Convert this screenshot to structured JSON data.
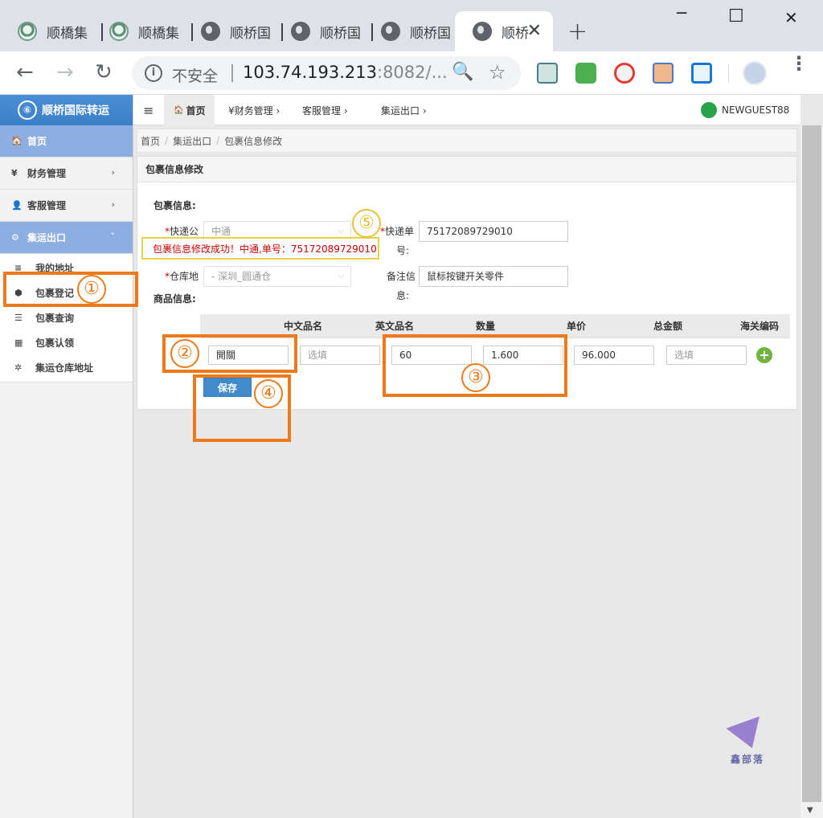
{
  "browser": {
    "tabs": [
      {
        "title": "顺橋集"
      },
      {
        "title": "顺橋集"
      },
      {
        "title": "顺桥国"
      },
      {
        "title": "顺桥国"
      },
      {
        "title": "顺桥国"
      },
      {
        "title": "顺桥"
      }
    ],
    "close_glyph": "✕",
    "new_tab_glyph": "+",
    "window_controls": {
      "minimize": "─",
      "maximize": "☐",
      "close": "✕"
    },
    "nav": {
      "back": "←",
      "forward": "→",
      "reload": "↻"
    },
    "security_label": "不安全",
    "url_host": "103.74.193.213",
    "url_rest": ":8082/...",
    "icons": {
      "zoom": "🔍",
      "star": "☆",
      "menu": "⋮",
      "info": "i"
    }
  },
  "app": {
    "brand": "顺桥国际转运",
    "brand_logo": "⑥",
    "sidebar": {
      "items": [
        {
          "icon": "🏠",
          "label": "首页"
        },
        {
          "icon": "¥",
          "label": "财务管理",
          "chevron": "›"
        },
        {
          "icon": "👤",
          "label": "客服管理",
          "chevron": "›"
        },
        {
          "icon": "⚙",
          "label": "集运出口",
          "chevron": "˅"
        }
      ],
      "sub_items": [
        {
          "icon": "≡",
          "label": "我的地址"
        },
        {
          "icon": "⬢",
          "label": "包裹登记"
        },
        {
          "icon": "☰",
          "label": "包裹查询"
        },
        {
          "icon": "▦",
          "label": "包裹认领"
        },
        {
          "icon": "✲",
          "label": "集运仓库地址"
        }
      ]
    },
    "topnav": {
      "menu_glyph": "≡",
      "home": "首页",
      "home_icon": "🏠",
      "finance": "¥财务管理 ›",
      "service": "客服管理 ›",
      "export": "集运出口 ›",
      "user": "NEWGUEST88"
    },
    "breadcrumb": [
      "首页",
      "集运出口",
      "包裹信息修改"
    ],
    "panel_title": "包裹信息修改",
    "form": {
      "section_package": "包裹信息:",
      "courier_label": "快递公",
      "courier_value": "中通",
      "tracking_label_1": "快递单",
      "tracking_label_2": "号:",
      "tracking_value": "75172089729010",
      "warehouse_label": "仓库地",
      "warehouse_value": "- 深圳_圆通仓",
      "remark_label_1": "备注信",
      "remark_label_2": "息:",
      "remark_value": "鼠标按键开关零件",
      "section_goods": "商品信息:",
      "required_mark": "*"
    },
    "success_message": "包裹信息修改成功！中通,单号：75172089729010",
    "table": {
      "headers": [
        "中文品名",
        "英文品名",
        "数量",
        "单价",
        "总金额",
        "海关编码"
      ],
      "row": {
        "cn_name": "開關",
        "en_name_placeholder": "选填",
        "quantity": "60",
        "unit_price": "1.600",
        "total": "96.000",
        "hs_code_placeholder": "选填"
      },
      "add_glyph": "+"
    },
    "save_label": "保存"
  },
  "annotations": [
    "①",
    "②",
    "③",
    "④",
    "⑤"
  ],
  "watermark": "鑫部落",
  "colors": {
    "annotation": "#ec7a1b",
    "annotation_yellow": "#e8c13a",
    "brand": "#3a7fc8",
    "sidebar_active": "#8caee0",
    "save_button": "#428bca",
    "success_text": "#cc0000"
  }
}
